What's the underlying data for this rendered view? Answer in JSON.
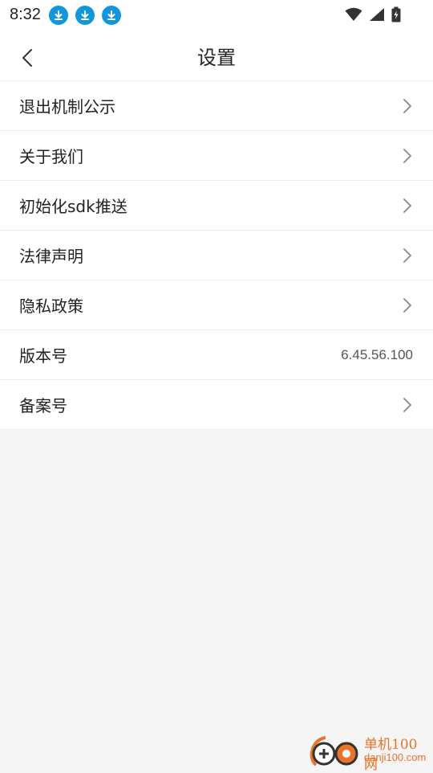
{
  "status_bar": {
    "time": "8:32",
    "icons": [
      "download-icon",
      "download-icon",
      "download-icon",
      "wifi-icon",
      "signal-icon",
      "battery-charging-icon"
    ]
  },
  "header": {
    "title": "设置",
    "back_icon": "chevron-left-icon"
  },
  "settings": {
    "items": [
      {
        "label": "退出机制公示",
        "value": "",
        "chevron": true
      },
      {
        "label": "关于我们",
        "value": "",
        "chevron": true
      },
      {
        "label": "初始化sdk推送",
        "value": "",
        "chevron": true
      },
      {
        "label": "法律声明",
        "value": "",
        "chevron": true
      },
      {
        "label": "隐私政策",
        "value": "",
        "chevron": true
      },
      {
        "label": "版本号",
        "value": "6.45.56.100",
        "chevron": false
      },
      {
        "label": "备案号",
        "value": "",
        "chevron": true
      }
    ]
  },
  "watermark": {
    "name": "单机100网",
    "url": "danji100.com"
  },
  "colors": {
    "accent_blue": "#1296db",
    "background": "#f5f5f5",
    "watermark_orange": "#e8732a"
  }
}
